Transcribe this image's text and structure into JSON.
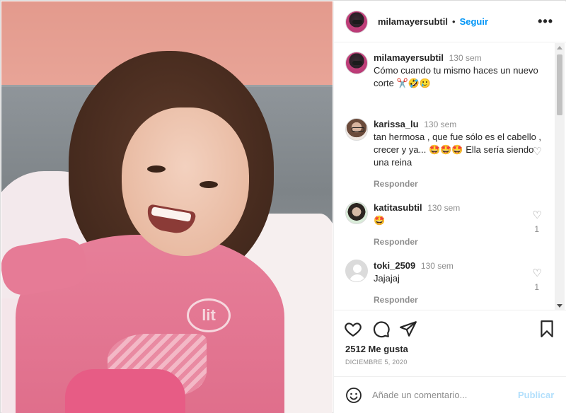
{
  "post": {
    "username": "milamayersubtil",
    "follow_label": "Seguir",
    "more_label": "•••",
    "caption": {
      "username": "milamayersubtil",
      "time": "130 sem",
      "text": "Cómo cuando tu mismo haces un nuevo corte ✂️🤣🥲"
    },
    "photo_logo": "lit"
  },
  "comments": [
    {
      "username": "karissa_lu",
      "time": "130 sem",
      "text": "tan hermosa , que fue sólo es el cabello , crecer y ya... 🤩🤩🤩 Ella sería siendo una reina",
      "reply_label": "Responder",
      "likes": ""
    },
    {
      "username": "katitasubtil",
      "time": "130 sem",
      "text": "🤩",
      "reply_label": "Responder",
      "likes": "1"
    },
    {
      "username": "toki_2509",
      "time": "130 sem",
      "text": "Jajajaj",
      "reply_label": "Responder",
      "likes": "1"
    }
  ],
  "actions": {
    "likes_text": "2512 Me gusta",
    "date_text": "DICIEMBRE 5, 2020"
  },
  "add_comment": {
    "placeholder": "Añade un comentario...",
    "publish_label": "Publicar"
  },
  "colors": {
    "accent": "#0095f6",
    "publish_disabled": "#b2dffc",
    "muted": "#8e8e8e"
  }
}
